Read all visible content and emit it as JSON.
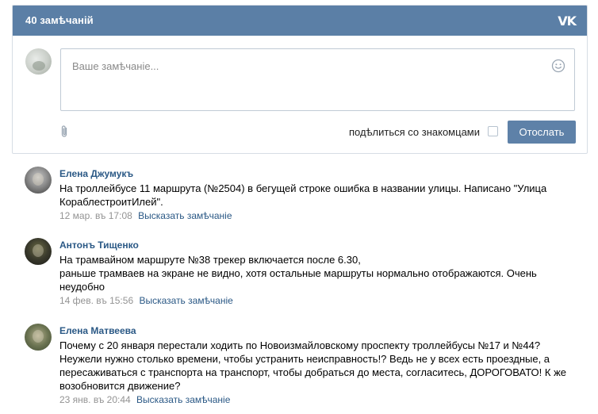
{
  "header": {
    "title": "40 замѣчаній",
    "logo": "vk-logo"
  },
  "composer": {
    "placeholder": "Ваше замѣчаніе...",
    "share_label": "подѣлиться со знакомцами",
    "share_checked": false,
    "send_label": "Отослать",
    "attach_icon": "paperclip-icon",
    "emoji_icon": "smile-icon"
  },
  "colors": {
    "header_bg": "#5b7fa6",
    "button_bg": "#5e81a8",
    "link": "#2a5885",
    "date": "#939393"
  },
  "comments": [
    {
      "author": "Елена Джумукъ",
      "text": "На троллейбусе 11 маршрута (№2504) в бегущей строке ошибка в названии улицы. Написано \"Улица КораблестроитИлей\".",
      "date": "12 мар. въ 17:08",
      "reply_label": "Высказать замѣчаніе"
    },
    {
      "author": "Антонъ Тищенко",
      "text": "На трамвайном маршруте №38 трекер включается после 6.30,\nраньше трамваев на экране не видно, хотя остальные маршруты нормально отображаются. Очень неудобно",
      "date": "14 фев. въ 15:56",
      "reply_label": "Высказать замѣчаніе"
    },
    {
      "author": "Елена Матвеева",
      "text": "Почему с 20 января перестали ходить по Новоизмайловскому проспекту троллейбусы №17 и №44? Неужели нужно столько времени, чтобы устранить неисправность!? Ведь не у всех есть проездные, а пересаживаться с транспорта на транспорт, чтобы добраться до места, согласитесь, ДОРОГОВАТО! К же возобновится движение?",
      "date": "23 янв. въ 20:44",
      "reply_label": "Высказать замѣчаніе"
    }
  ]
}
